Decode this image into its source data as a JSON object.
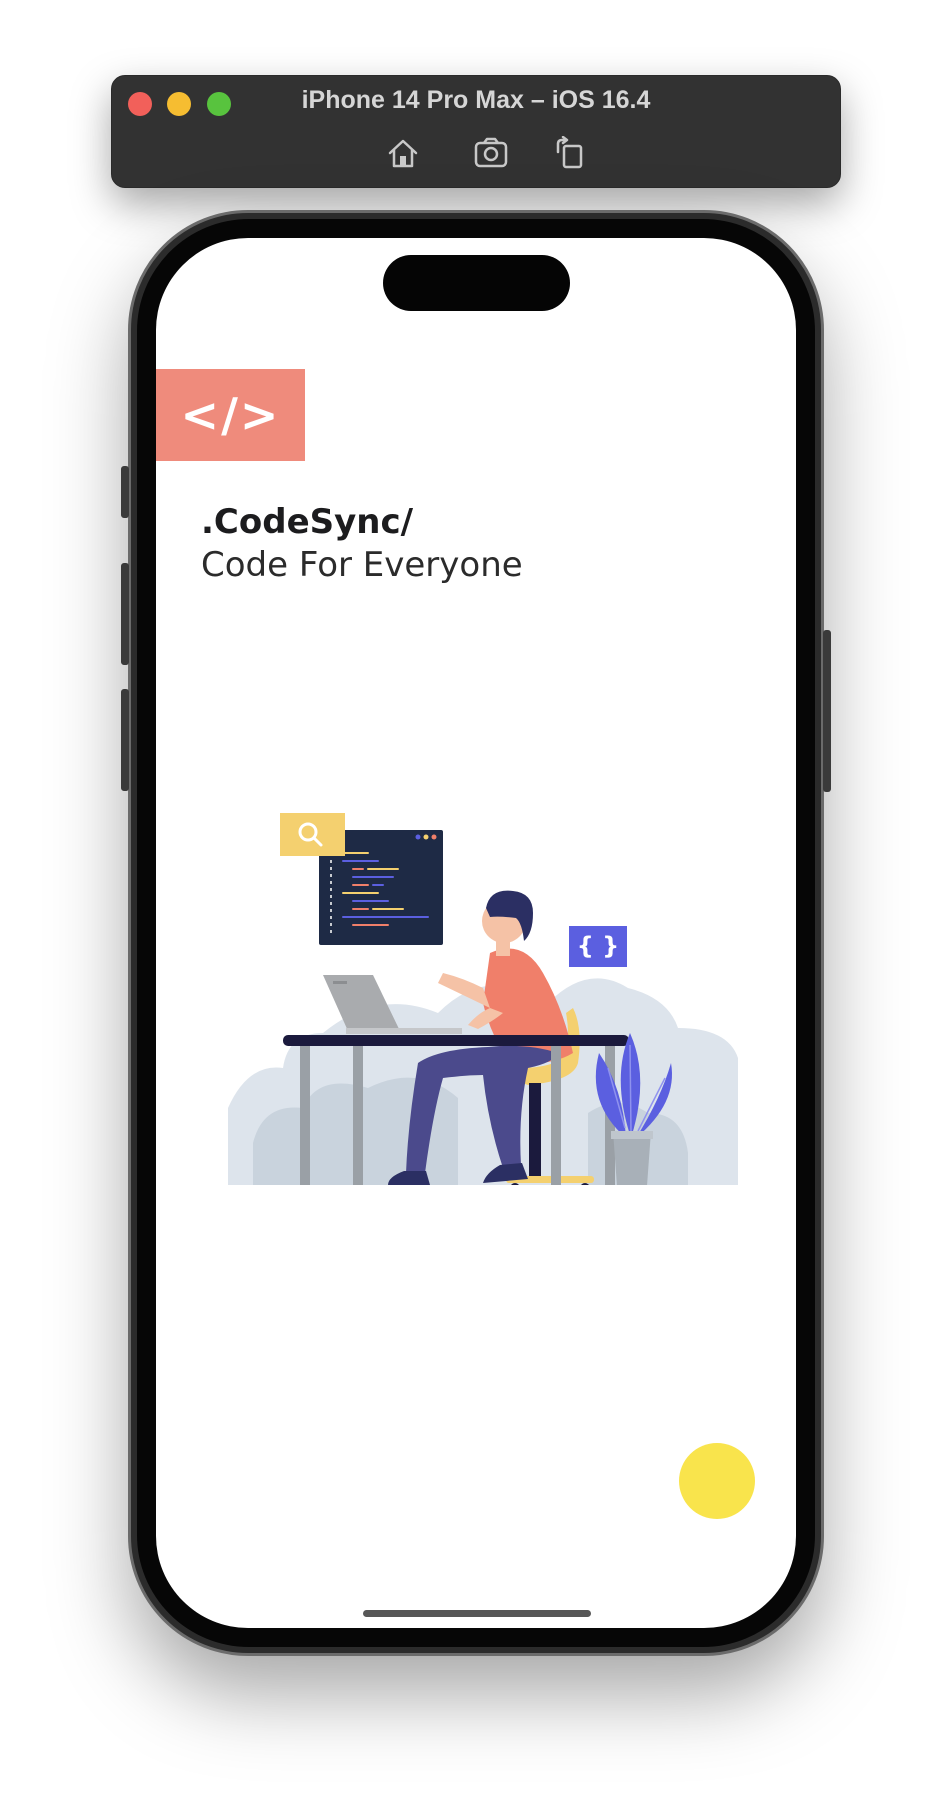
{
  "simulator": {
    "title": "iPhone 14 Pro Max – iOS 16.4",
    "buttons": [
      "home",
      "screenshot",
      "rotate"
    ],
    "icons": {
      "home": "home-icon",
      "screenshot": "camera-icon",
      "rotate": "rotate-icon"
    }
  },
  "app": {
    "logo_text": "</>",
    "brand": ".CodeSync/",
    "tagline": "Code For Everyone",
    "illustration_badge": "{ }",
    "colors": {
      "logo_bg": "#ef8b7c",
      "fab": "#f9e44c",
      "accent_blue": "#5b5fe0",
      "search_badge": "#f4d06f",
      "shirt": "#f07f6a",
      "pants": "#4b4a8c",
      "desk": "#1b1a3d"
    }
  }
}
